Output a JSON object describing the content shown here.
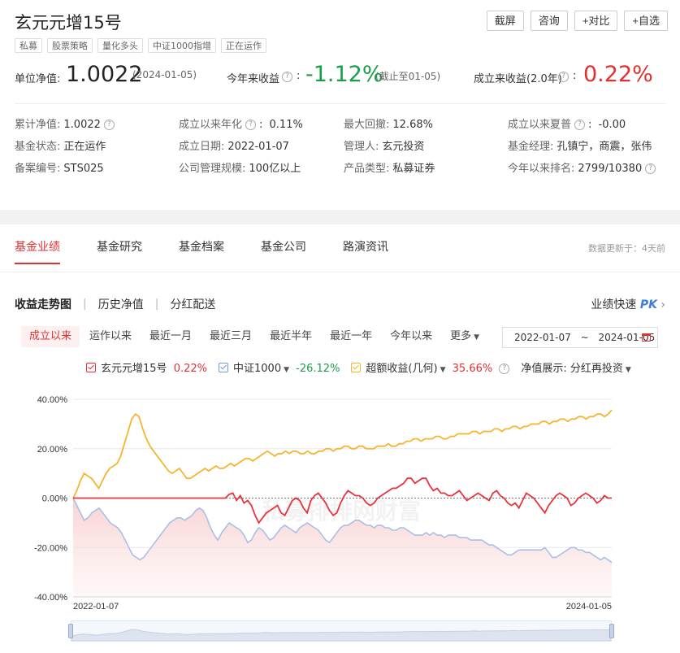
{
  "fund": {
    "name": "玄元元增15号",
    "tags": [
      "私募",
      "股票策略",
      "量化多头",
      "中证1000指增",
      "正在运作"
    ]
  },
  "toolbar": [
    "截屏",
    "咨询",
    "+对比",
    "+自选"
  ],
  "kpi": {
    "nav_label": "单位净值:",
    "nav_value": "1.0022",
    "nav_date": "(2024-01-05)",
    "ytd_label": "今年来收益",
    "ytd_value": "-1.12%",
    "ytd_note": "(截止至01-05)",
    "since_label": "成立来收益(2.0年)",
    "since_value": "0.22%"
  },
  "info": [
    {
      "k": "累计净值:",
      "v": "1.0022",
      "help": true
    },
    {
      "k": "成立以来年化",
      "v": "0.11%",
      "help": true
    },
    {
      "k": "最大回撤:",
      "v": "12.68%"
    },
    {
      "k": "成立以来夏普",
      "v": "-0.00",
      "help": true
    },
    {
      "k": "基金状态:",
      "v": "正在运作"
    },
    {
      "k": "成立日期:",
      "v": "2022-01-07"
    },
    {
      "k": "管理人:",
      "v": "玄元投资",
      "link": true
    },
    {
      "k": "基金经理:",
      "v": "孔镇宁，商震，张伟",
      "link": true
    },
    {
      "k": "备案编号:",
      "v": "STS025"
    },
    {
      "k": "公司管理规模:",
      "v": "100亿以上"
    },
    {
      "k": "产品类型:",
      "v": "私募证券"
    },
    {
      "k": "今年以来排名:",
      "v": "2799/10380",
      "help": true
    }
  ],
  "main_tabs": [
    "基金业绩",
    "基金研究",
    "基金档案",
    "基金公司",
    "路演资讯"
  ],
  "update_note": "数据更新于：4天前",
  "sub_tabs": [
    "收益走势图",
    "历史净值",
    "分红配送"
  ],
  "pk_label": "业绩快速",
  "pk_badge": "PK",
  "ranges": [
    "成立以来",
    "运作以来",
    "最近一月",
    "最近三月",
    "最近半年",
    "最近一年",
    "今年以来",
    "更多"
  ],
  "date_range": {
    "start": "2022-01-07",
    "sep": "~",
    "end": "2024-01-05"
  },
  "legend": {
    "fund": {
      "name": "玄元元增15号",
      "value": "0.22%"
    },
    "index": {
      "name": "中证1000",
      "value": "-26.12%"
    },
    "excess": {
      "name": "超额收益(几何)",
      "value": "35.66%"
    },
    "nav_show_label": "净值展示:",
    "nav_show_value": "分红再投资"
  },
  "colors": {
    "fund": "#e8323c",
    "index": "#a8bfe8",
    "excess": "#f5b52e",
    "accent": "#e03131",
    "green": "#1a9e4b"
  },
  "watermark": "私募排排网财富",
  "chart_data": {
    "type": "line",
    "x_start": "2022-01-07",
    "x_end": "2024-01-05",
    "x_ticks": [
      "2022-01-07",
      "2024-01-05"
    ],
    "ylim": [
      -40,
      40
    ],
    "y_ticks": [
      "40.00%",
      "20.00%",
      "0.00%",
      "-20.00%",
      "-40.00%"
    ],
    "series": [
      {
        "name": "玄元元增15号",
        "values": [
          0,
          0,
          0,
          0,
          0,
          0,
          0,
          0,
          0,
          0,
          0,
          0,
          0,
          0,
          0,
          0,
          0,
          0,
          0,
          0,
          0,
          0,
          0,
          0,
          0,
          0,
          0,
          0,
          0,
          0,
          0,
          0,
          0,
          0,
          0,
          0,
          0,
          0,
          0,
          0,
          0,
          0,
          1.5,
          2,
          -1,
          1,
          -2,
          -1,
          -3,
          -7,
          -10,
          -8,
          -6,
          -5,
          -4,
          -3,
          -6,
          -7,
          -4,
          -1,
          0,
          -1,
          -4,
          -6,
          -1,
          1,
          2,
          0,
          -2,
          -5,
          -7,
          -6,
          -2,
          1,
          3,
          2,
          1,
          1,
          0,
          -2,
          -3,
          -2,
          0,
          1,
          2,
          3,
          4,
          4,
          5,
          6,
          8,
          8,
          6,
          7,
          8,
          8,
          5,
          3,
          4,
          2,
          2,
          1,
          1,
          2,
          3,
          1,
          -1,
          0,
          1,
          2,
          1,
          0,
          -1,
          2,
          3,
          1,
          0,
          -2,
          -3,
          -2,
          -4,
          -1,
          2,
          1,
          0,
          -2,
          -4,
          -6,
          -3,
          -1,
          1,
          2,
          1,
          0,
          -3,
          -2,
          0,
          1,
          2,
          1,
          0,
          -2,
          -1,
          1,
          0,
          0
        ]
      },
      {
        "name": "中证1000",
        "values": [
          0,
          -3,
          -6,
          -9,
          -8,
          -6,
          -5,
          -4,
          -6,
          -8,
          -10,
          -11,
          -12,
          -14,
          -17,
          -20,
          -23,
          -24,
          -25,
          -24,
          -22,
          -20,
          -18,
          -16,
          -14,
          -12,
          -10,
          -9,
          -8,
          -8,
          -9,
          -8,
          -7,
          -5,
          -4,
          -5,
          -8,
          -12,
          -15,
          -17,
          -14,
          -12,
          -10,
          -11,
          -12,
          -13,
          -15,
          -18,
          -17,
          -14,
          -12,
          -13,
          -15,
          -17,
          -16,
          -14,
          -12,
          -11,
          -12,
          -13,
          -14,
          -12,
          -11,
          -10,
          -11,
          -12,
          -13,
          -15,
          -17,
          -18,
          -16,
          -14,
          -12,
          -11,
          -11,
          -10,
          -9,
          -9,
          -10,
          -11,
          -11,
          -12,
          -11,
          -11,
          -12,
          -12,
          -13,
          -13,
          -12,
          -12,
          -13,
          -14,
          -15,
          -15,
          -15,
          -14,
          -15,
          -14,
          -15,
          -15,
          -16,
          -15,
          -15,
          -15,
          -16,
          -16,
          -16,
          -17,
          -17,
          -17,
          -17,
          -18,
          -19,
          -19,
          -20,
          -21,
          -22,
          -23,
          -23,
          -22,
          -21,
          -21,
          -21,
          -21,
          -21,
          -21,
          -21,
          -20,
          -22,
          -24,
          -24,
          -23,
          -22,
          -21,
          -20,
          -20,
          -21,
          -21,
          -22,
          -22,
          -23,
          -24,
          -25,
          -24,
          -25,
          -26.12
        ]
      },
      {
        "name": "超额收益(几何)",
        "values": [
          0,
          3,
          7,
          10,
          9,
          8,
          6,
          4,
          7,
          10,
          12,
          13,
          14,
          17,
          22,
          27,
          32,
          34,
          33,
          28,
          24,
          21,
          19,
          17,
          15,
          13,
          11,
          10,
          11,
          12,
          10,
          8,
          8,
          9,
          10,
          11,
          12,
          11,
          12,
          13,
          12,
          12,
          13,
          14,
          13,
          14,
          15,
          16,
          16,
          15,
          16,
          17,
          18,
          19,
          18,
          17,
          18,
          18,
          19,
          18,
          19,
          19,
          18,
          18,
          19,
          18,
          18,
          19,
          19,
          20,
          20,
          19,
          20,
          20,
          21,
          21,
          20,
          20,
          21,
          21,
          20,
          20,
          20,
          21,
          21,
          21,
          22,
          21,
          21,
          22,
          22,
          23,
          23,
          24,
          24,
          23,
          24,
          24,
          24,
          25,
          25,
          24,
          24,
          25,
          25,
          26,
          26,
          26,
          26,
          27,
          27,
          26,
          27,
          27,
          27,
          28,
          28,
          27,
          28,
          28,
          29,
          29,
          28,
          29,
          29,
          30,
          30,
          30,
          31,
          31,
          30,
          31,
          31,
          32,
          32,
          31,
          32,
          32,
          33,
          33,
          32,
          33,
          33,
          34,
          34,
          33,
          34,
          35.66
        ]
      }
    ]
  }
}
